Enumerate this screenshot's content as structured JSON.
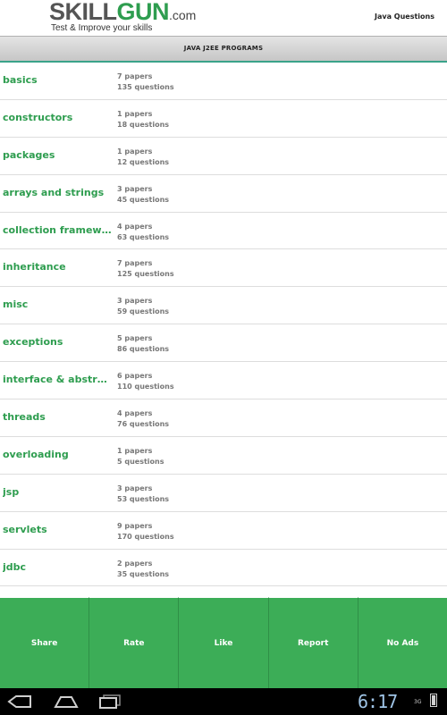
{
  "header": {
    "logo_skill": "SKILL",
    "logo_gun": "GUN",
    "logo_domain": ".com",
    "tagline": "Test & Improve your skills",
    "right_title": "Java Questions"
  },
  "section": {
    "title": "JAVA J2EE PROGRAMS"
  },
  "topics": [
    {
      "title": "basics",
      "papers": "7 papers",
      "questions": "135 questions"
    },
    {
      "title": "constructors",
      "papers": "1 papers",
      "questions": "18 questions"
    },
    {
      "title": "packages",
      "papers": "1 papers",
      "questions": "12 questions"
    },
    {
      "title": "arrays and strings",
      "papers": "3 papers",
      "questions": "45 questions"
    },
    {
      "title": "collection framework",
      "papers": "4 papers",
      "questions": "63 questions"
    },
    {
      "title": "inheritance",
      "papers": "7 papers",
      "questions": "125 questions"
    },
    {
      "title": "misc",
      "papers": "3 papers",
      "questions": "59 questions"
    },
    {
      "title": "exceptions",
      "papers": "5 papers",
      "questions": "86 questions"
    },
    {
      "title": "interface & abstract...",
      "papers": "6 papers",
      "questions": "110 questions"
    },
    {
      "title": "threads",
      "papers": "4 papers",
      "questions": "76 questions"
    },
    {
      "title": "overloading",
      "papers": "1 papers",
      "questions": "5 questions"
    },
    {
      "title": "jsp",
      "papers": "3 papers",
      "questions": "53 questions"
    },
    {
      "title": "servlets",
      "papers": "9 papers",
      "questions": "170 questions"
    },
    {
      "title": "jdbc",
      "papers": "2 papers",
      "questions": "35 questions"
    }
  ],
  "actions": {
    "share": "Share",
    "rate": "Rate",
    "like": "Like",
    "report": "Report",
    "no_ads": "No Ads"
  },
  "status": {
    "time": "6:17",
    "network": "3G"
  },
  "colors": {
    "accent": "#2e9d4f",
    "action_bar": "#3cad57",
    "section_underline": "#3aa38a"
  }
}
